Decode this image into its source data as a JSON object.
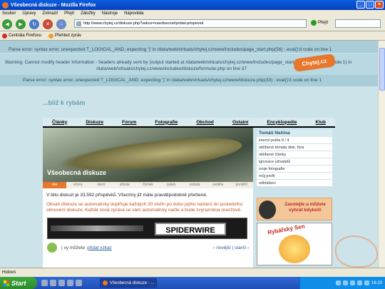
{
  "window": {
    "title": "Všeobecná diskuze - Mozilla Firefox",
    "buttons": [
      "_",
      "□",
      "×"
    ]
  },
  "menu": [
    "Soubor",
    "Úpravy",
    "Zobrazit",
    "Přejít",
    "Záložky",
    "Nástroje",
    "Nápověda"
  ],
  "nav": {
    "url": "http://www.chytej.cz/diskuze.php?sekce=vseobecna#pridat-prispevek",
    "go_label": "Přejít"
  },
  "bookmarks": [
    "Centrála Firefoxu",
    "Přehled zpráv"
  ],
  "errors": {
    "e1": "Parse error: syntax error, unexpected T_LOGICAL_AND, expecting ')' in /data/web/virtuals/chytej.cz/www/includes/page_start.php(56) : eval()'d code on line 1",
    "e2a": "Warning: Cannot modify header information - headers already sent by (output started at /data/web/virtuals/chytej.cz/www/includes/page_start.php(56) : eval()'d code:1) in",
    "e2b": "/data/web/virtuals/chytej.cz/www/includes/diskuze/formular.php on line 37",
    "e3": "Parse error: syntax error, unexpected T_LOGICAL_AND, expecting ')' in /data/web/virtuals/chytej.cz/www/diskuze.php(33) : eval()'d code on line 1"
  },
  "site": {
    "logo": "Chytej.cz",
    "slogan": "...blíž k rybám",
    "topnav": [
      "Články",
      "Diskuze",
      "Fórum",
      "Fotografie",
      "Obchod",
      "Ostatní",
      "Encyklopedie",
      "Klub"
    ]
  },
  "main": {
    "banner_title": "Všeobecná diskuze",
    "days": [
      "vše",
      "včera",
      "úterý",
      "středa",
      "čtvrtek",
      "pátek",
      "sobota",
      "neděle",
      "pondělí"
    ],
    "active_day": 0,
    "text1": "V této diskuzi je 33,592 příspěvků. Všechny již máte pravděpodobně přečtené.",
    "text2": "Obsah diskuze se automaticky doplňuje každých 30 vteřin po dobu jejího načtení do posledního obnovení diskuze. Každá nová zpráva se vám automaticky načte a bude zvýrazněna oranžově.",
    "ad_brand": "SPIDERWIRE",
    "post": {
      "prefix": "| vy můžete",
      "link": "přidat vzkaz",
      "pager": "‹ novější | starší ›"
    }
  },
  "sidebar": {
    "user": "Tomáš Nečina",
    "items": [
      "interní pošta 0 / 4",
      "oblíbená témata disk. fóra",
      "oblíbené články",
      "ignorace uživatelů",
      "moje fotografie",
      "můj profil",
      "odhlášení"
    ],
    "ad1": "Zavolejte a můžete vyhrát kdykoli!",
    "ad2": "Rybářský Sen"
  },
  "statusbar": "Hotovo",
  "taskbar": {
    "start": "Start",
    "task": "Všeobecná diskuze - ...",
    "clock": "16:20"
  }
}
